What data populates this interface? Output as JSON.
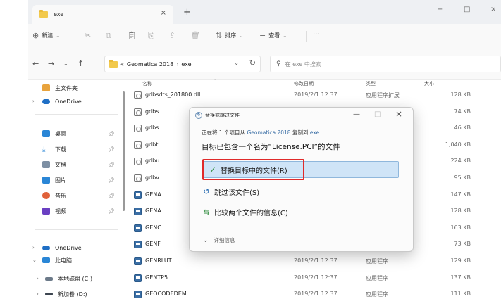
{
  "tab": {
    "title": "exe",
    "close": "×",
    "add": "+"
  },
  "window_controls": {
    "minimize": "−",
    "maximize": "□",
    "close": "×"
  },
  "toolbar": {
    "new_label": "新建",
    "sort_label": "排序",
    "view_label": "查看",
    "more_label": "···"
  },
  "address": {
    "overflow": "«",
    "path": [
      "Geomatica 2018",
      "exe"
    ],
    "separator": "›",
    "search_placeholder": "在 exe 中搜索"
  },
  "sidebar": {
    "items": [
      {
        "label": "主文件夹",
        "icon": "home-icon",
        "color": "#e8a33d"
      },
      {
        "label": "OneDrive",
        "icon": "cloud-icon",
        "color": "#1f6fc5"
      },
      {
        "label": "桌面",
        "icon": "desktop-icon",
        "color": "#2a86d6"
      },
      {
        "label": "下载",
        "icon": "download-icon",
        "color": "#2a86d6"
      },
      {
        "label": "文档",
        "icon": "document-icon",
        "color": "#7d8fa3"
      },
      {
        "label": "图片",
        "icon": "picture-icon",
        "color": "#2a86d6"
      },
      {
        "label": "音乐",
        "icon": "music-icon",
        "color": "#e0613a"
      },
      {
        "label": "视频",
        "icon": "video-icon",
        "color": "#6a3fc2"
      },
      {
        "label": "OneDrive",
        "icon": "cloud-icon",
        "color": "#1f6fc5"
      },
      {
        "label": "此电脑",
        "icon": "computer-icon",
        "color": "#2a86d6"
      },
      {
        "label": "本地磁盘 (C:)",
        "icon": "drive-icon",
        "color": "#6c7a89"
      },
      {
        "label": "新加卷 (D:)",
        "icon": "drive-icon",
        "color": "#6c7a89"
      }
    ]
  },
  "filelist": {
    "columns": {
      "name": "名称",
      "date": "修改日期",
      "type": "类型",
      "size": "大小"
    },
    "rows": [
      {
        "name": "gdbsdts_201800.dll",
        "date": "2019/2/1 12:37",
        "type": "应用程序扩展",
        "size": "128 KB",
        "kind": "dll"
      },
      {
        "name": "gdbs",
        "date": "",
        "type": "",
        "size": "74 KB",
        "kind": "dll"
      },
      {
        "name": "gdbs",
        "date": "",
        "type": "",
        "size": "46 KB",
        "kind": "dll"
      },
      {
        "name": "gdbt",
        "date": "",
        "type": "",
        "size": "1,040 KB",
        "kind": "dll"
      },
      {
        "name": "gdbu",
        "date": "",
        "type": "",
        "size": "224 KB",
        "kind": "dll"
      },
      {
        "name": "gdbv",
        "date": "",
        "type": "",
        "size": "95 KB",
        "kind": "dll"
      },
      {
        "name": "GENA",
        "date": "",
        "type": "",
        "size": "147 KB",
        "kind": "exe"
      },
      {
        "name": "GENA",
        "date": "",
        "type": "",
        "size": "128 KB",
        "kind": "exe"
      },
      {
        "name": "GENC",
        "date": "",
        "type": "",
        "size": "163 KB",
        "kind": "exe"
      },
      {
        "name": "GENF",
        "date": "",
        "type": "",
        "size": "73 KB",
        "kind": "exe"
      },
      {
        "name": "GENRLUT",
        "date": "2019/2/1 12:37",
        "type": "应用程序",
        "size": "129 KB",
        "kind": "exe"
      },
      {
        "name": "GENTP5",
        "date": "2019/2/1 12:37",
        "type": "应用程序",
        "size": "137 KB",
        "kind": "exe"
      },
      {
        "name": "GEOCODEDEM",
        "date": "2019/2/1 12:37",
        "type": "应用程序",
        "size": "111 KB",
        "kind": "exe"
      }
    ]
  },
  "dialog": {
    "title": "替换或跳过文件",
    "info_prefix": "正在将 1 个项目从 ",
    "info_source": "Geomatica 2018",
    "info_mid": " 复制到 ",
    "info_dest": "exe",
    "heading": "目标已包含一个名为“License.PCI”的文件",
    "options": {
      "replace": "替换目标中的文件(R)",
      "skip": "跳过该文件(S)",
      "compare": "比较两个文件的信息(C)"
    },
    "details": "详细信息",
    "controls": {
      "minimize": "—",
      "maximize": "□",
      "close": "×"
    }
  }
}
